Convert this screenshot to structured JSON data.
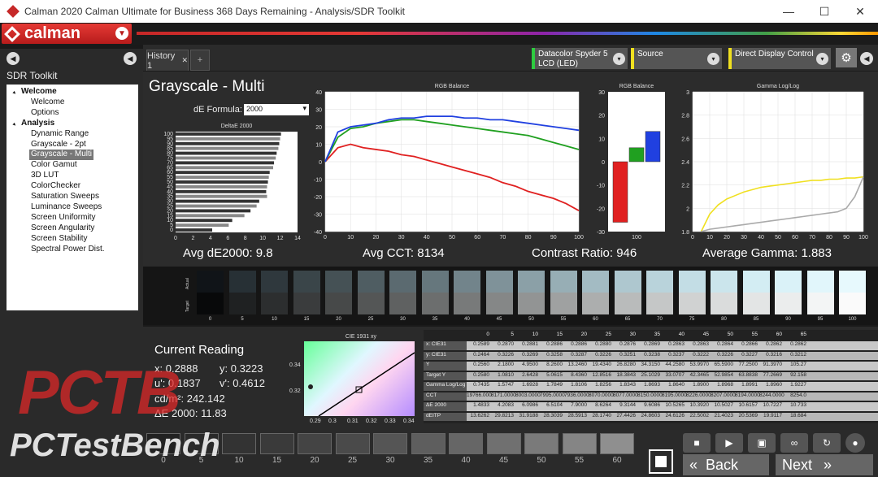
{
  "window": {
    "title": "Calman 2020 Calman Ultimate for Business 368 Days Remaining - Analysis/SDR Toolkit",
    "minimize": "—",
    "maximize": "☐",
    "close": "✕"
  },
  "brand": {
    "name": "calman"
  },
  "sidebar": {
    "title": "SDR Toolkit",
    "groups": [
      {
        "label": "Welcome",
        "items": [
          "Welcome",
          "Options"
        ]
      },
      {
        "label": "Analysis",
        "items": [
          "Dynamic Range",
          "Grayscale - 2pt",
          "Grayscale - Multi",
          "Color Gamut",
          "3D LUT",
          "ColorChecker",
          "Saturation Sweeps",
          "Luminance Sweeps",
          "Screen Uniformity",
          "Screen Angularity",
          "Screen Stability",
          "Spectral Power Dist."
        ]
      }
    ],
    "selected": "Grayscale - Multi"
  },
  "tabs": {
    "history": "History 1",
    "close": "✕",
    "add": "+"
  },
  "devices": {
    "meter": "Datacolor Spyder 5\nLCD (LED)",
    "meter_color": "#2ecc40",
    "source": "Source",
    "source_color": "#f0e020",
    "display": "Direct Display Control",
    "display_color": "#f0e020",
    "dropdown": "▾"
  },
  "page": {
    "title": "Grayscale - Multi",
    "de_label": "dE Formula:",
    "de_value": "2000"
  },
  "stats": {
    "avg_de": "Avg dE2000: 9.8",
    "avg_cct": "Avg CCT: 8134",
    "contrast": "Contrast Ratio: 946",
    "gamma": "Average Gamma: 1.883"
  },
  "chart_data": [
    {
      "type": "bar",
      "title": "DeltaE 2000",
      "orientation": "horizontal",
      "categories": [
        "0",
        "5",
        "10",
        "15",
        "20",
        "25",
        "30",
        "35",
        "40",
        "45",
        "50",
        "55",
        "60",
        "65",
        "70",
        "75",
        "80",
        "85",
        "90",
        "95",
        "100"
      ],
      "values": [
        4.2,
        6.1,
        6.5,
        7.9,
        8.6,
        9.3,
        9.6,
        10.5,
        10.4,
        10.5,
        10.6,
        10.7,
        10.8,
        11.2,
        11.3,
        11.5,
        11.6,
        11.8,
        11.9,
        12.0,
        12.1
      ],
      "xlim": [
        0,
        14
      ],
      "xticks": [
        "0",
        "2",
        "4",
        "6",
        "8",
        "10",
        "12",
        "14"
      ],
      "yticks": [
        "0",
        "5",
        "10",
        "15",
        "20",
        "25",
        "30",
        "35",
        "40",
        "45",
        "50",
        "55",
        "60",
        "65",
        "70",
        "75",
        "80",
        "85",
        "90",
        "95",
        "100"
      ]
    },
    {
      "type": "line",
      "title": "RGB Balance",
      "x": [
        0,
        5,
        10,
        15,
        20,
        25,
        30,
        35,
        40,
        45,
        50,
        55,
        60,
        65,
        70,
        75,
        80,
        85,
        90,
        95,
        100
      ],
      "ylim": [
        -40,
        40
      ],
      "yticks": [
        "40",
        "30",
        "20",
        "10",
        "0",
        "-10",
        "-20",
        "-30",
        "-40"
      ],
      "xticks": [
        "0",
        "10",
        "20",
        "30",
        "40",
        "50",
        "60",
        "70",
        "80",
        "90",
        "100"
      ],
      "series": [
        {
          "name": "Red",
          "color": "#e02020",
          "values": [
            0,
            8,
            10,
            8,
            7,
            6,
            4,
            3,
            1,
            -1,
            -3,
            -5,
            -7,
            -9,
            -12,
            -14,
            -17,
            -19,
            -21,
            -24,
            -28
          ]
        },
        {
          "name": "Green",
          "color": "#20a020",
          "values": [
            0,
            14,
            19,
            20,
            22,
            23,
            24,
            24,
            23,
            22,
            21,
            20,
            19,
            18,
            17,
            16,
            15,
            13,
            11,
            9,
            7
          ]
        },
        {
          "name": "Blue",
          "color": "#2040e0",
          "values": [
            0,
            17,
            20,
            21,
            22,
            24,
            25,
            25,
            26,
            26,
            26,
            25,
            25,
            24,
            24,
            23,
            22,
            21,
            20,
            19,
            18
          ]
        }
      ]
    },
    {
      "type": "bar",
      "title": "RGB Balance",
      "categories": [
        "R",
        "G",
        "B"
      ],
      "colors": [
        "#e02020",
        "#20a020",
        "#2040e0"
      ],
      "values": [
        -26,
        6,
        13
      ],
      "ylim": [
        -30,
        30
      ],
      "yticks": [
        "30",
        "20",
        "10",
        "0",
        "-10",
        "-20",
        "-30"
      ],
      "xticks": [
        "100"
      ]
    },
    {
      "type": "line",
      "title": "Gamma Log/Log",
      "x": [
        5,
        10,
        15,
        20,
        25,
        30,
        35,
        40,
        45,
        50,
        55,
        60,
        65,
        70,
        75,
        80,
        85,
        90,
        95,
        100
      ],
      "ylim": [
        1.8,
        3.0
      ],
      "yticks": [
        "3",
        "2.8",
        "2.6",
        "2.4",
        "2.2",
        "2",
        "1.8"
      ],
      "xticks": [
        "0",
        "10",
        "20",
        "30",
        "40",
        "50",
        "60",
        "70",
        "80",
        "90",
        "100"
      ],
      "series": [
        {
          "name": "Measured",
          "color": "#f0e020",
          "values": [
            1.8,
            1.95,
            2.03,
            2.08,
            2.11,
            2.14,
            2.16,
            2.18,
            2.19,
            2.2,
            2.21,
            2.22,
            2.23,
            2.24,
            2.24,
            2.25,
            2.25,
            2.26,
            2.26,
            2.27
          ]
        },
        {
          "name": "Target",
          "color": "#aaaaaa",
          "values": [
            1.8,
            1.82,
            1.83,
            1.84,
            1.85,
            1.86,
            1.87,
            1.88,
            1.89,
            1.9,
            1.91,
            1.92,
            1.93,
            1.94,
            1.95,
            1.96,
            1.97,
            2.0,
            2.1,
            2.27
          ]
        }
      ]
    },
    {
      "type": "scatter",
      "title": "CIE 1931 xy",
      "xticks": [
        "0.29",
        "0.3",
        "0.31",
        "0.32",
        "0.33",
        "0.34"
      ],
      "yticks": [
        "0.34",
        "0.32"
      ]
    }
  ],
  "swatches": {
    "actual_label": "Actual",
    "target_label": "Target",
    "labels": [
      "0",
      "5",
      "10",
      "15",
      "20",
      "25",
      "30",
      "35",
      "40",
      "45",
      "50",
      "55",
      "60",
      "65",
      "70",
      "75",
      "80",
      "85",
      "90",
      "95",
      "100"
    ],
    "actual": [
      "#101418",
      "#273035",
      "#2f383d",
      "#3a4549",
      "#455155",
      "#4f5d62",
      "#5b6a70",
      "#66777d",
      "#72848b",
      "#7f9299",
      "#8ba0a7",
      "#97aeb5",
      "#a3bbc3",
      "#aec7cf",
      "#b9d3db",
      "#c3dde5",
      "#cbe5ec",
      "#d3edf3",
      "#daf2f8",
      "#e1f6fb",
      "#e7f9fd"
    ],
    "target": [
      "#08090a",
      "#1f2122",
      "#2c2e2f",
      "#3a3c3d",
      "#474949",
      "#545656",
      "#5f6161",
      "#6c6e6e",
      "#787a7a",
      "#858787",
      "#929494",
      "#9fa1a1",
      "#acaeae",
      "#b9bbbb",
      "#c5c7c7",
      "#d0d2d2",
      "#dadcdc",
      "#e3e5e5",
      "#ebeded",
      "#f3f5f5",
      "#fafafa"
    ]
  },
  "reading": {
    "title": "Current Reading",
    "x": "x: 0.2888",
    "y": "y: 0.3223",
    "u": "u': 0.1837",
    "v": "v': 0.4612",
    "cd": "cd/m²: 242.142",
    "de": "ΔE 2000: 11.83"
  },
  "table": {
    "columns": [
      "0",
      "5",
      "10",
      "15",
      "20",
      "25",
      "30",
      "35",
      "40",
      "45",
      "50",
      "55",
      "60",
      "65"
    ],
    "rows": [
      {
        "label": "x: CIE31",
        "cells": [
          "0.2589",
          "0.2870",
          "0.2881",
          "0.2886",
          "0.2886",
          "0.2880",
          "0.2876",
          "0.2869",
          "0.2863",
          "0.2863",
          "0.2864",
          "0.2866",
          "0.2862",
          "0.2862"
        ]
      },
      {
        "label": "y: CIE31",
        "cells": [
          "0.2464",
          "0.3226",
          "0.3269",
          "0.3258",
          "0.3287",
          "0.3226",
          "0.3251",
          "0.3238",
          "0.3237",
          "0.3222",
          "0.3226",
          "0.3227",
          "0.3216",
          "0.3212"
        ]
      },
      {
        "label": "Y",
        "cells": [
          "0.2560",
          "2.1800",
          "4.9500",
          "8.2600",
          "13.2460",
          "19.4340",
          "26.8280",
          "34.3150",
          "44.2580",
          "53.9970",
          "65.5900",
          "77.2500",
          "91.3970",
          "105.27"
        ]
      },
      {
        "label": "Target Y",
        "cells": [
          "0.2580",
          "1.0810",
          "2.6428",
          "5.0615",
          "8.4360",
          "12.8516",
          "18.3843",
          "25.1029",
          "33.0707",
          "42.3465",
          "52.9854",
          "63.8838",
          "77.2669",
          "92.158"
        ]
      },
      {
        "label": "Gamma Log/Log",
        "cells": [
          "0.7435",
          "1.5747",
          "1.6928",
          "1.7849",
          "1.8106",
          "1.8256",
          "1.8343",
          "1.8693",
          "1.8640",
          "1.8900",
          "1.8968",
          "1.8991",
          "1.8960",
          "1.9227"
        ]
      },
      {
        "label": "CCT",
        "cells": [
          "19766.000",
          "8171.0000",
          "8003.0000",
          "7995.0000",
          "7936.0000",
          "8070.0000",
          "8077.0000",
          "8150.0000",
          "8195.0000",
          "8226.0000",
          "8207.0000",
          "8194.0000",
          "8244.0000",
          "8254.0"
        ]
      },
      {
        "label": "ΔE 2000",
        "cells": [
          "1.4833",
          "4.2083",
          "6.0986",
          "6.5104",
          "7.9000",
          "8.6264",
          "9.3144",
          "9.6086",
          "10.5265",
          "10.3920",
          "10.5027",
          "10.6157",
          "10.7227",
          "10.733"
        ]
      },
      {
        "label": "dEITP",
        "cells": [
          "13.6262",
          "29.8213",
          "31.9188",
          "28.3039",
          "28.5913",
          "28.1740",
          "27.4426",
          "24.8603",
          "24.6126",
          "22.5002",
          "21.4023",
          "20.5369",
          "19.9117",
          "18.684"
        ]
      }
    ]
  },
  "bottom": {
    "labels": [
      "0",
      "5",
      "10",
      "15",
      "20",
      "25",
      "30",
      "35",
      "40",
      "45",
      "50",
      "55",
      "60"
    ],
    "colors": [
      "#222",
      "#2a2a2a",
      "#333",
      "#3a3a3a",
      "#444",
      "#4a4a4a",
      "#555",
      "#5e5e5e",
      "#666",
      "#707070",
      "#7a7a7a",
      "#858585",
      "#8f8f8f"
    ],
    "back": "Back",
    "next": "Next"
  },
  "watermark": {
    "big": "PCTB",
    "small": "PCTestBench"
  }
}
